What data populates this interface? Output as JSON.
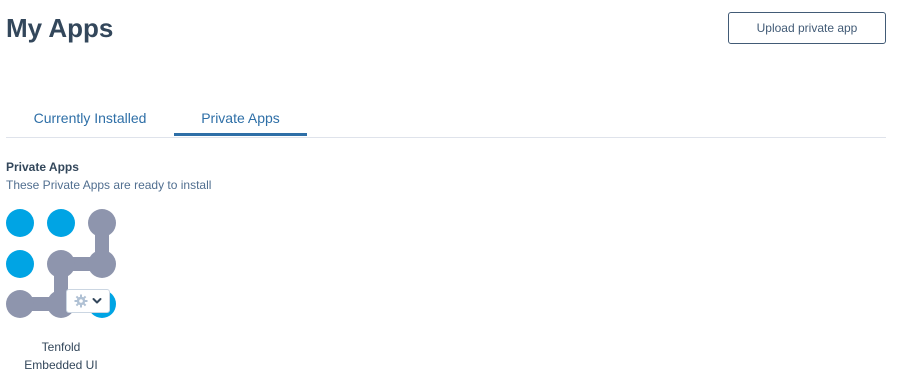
{
  "header": {
    "title": "My Apps",
    "upload_button_label": "Upload private app"
  },
  "tabs": [
    {
      "label": "Currently Installed",
      "active": false
    },
    {
      "label": "Private Apps",
      "active": true
    }
  ],
  "section": {
    "heading": "Private Apps",
    "subtitle": "These Private Apps are ready to install"
  },
  "apps": [
    {
      "name_line1": "Tenfold",
      "name_line2": "Embedded UI",
      "logo_icon": "tenfold-dots-logo",
      "menu_icons": [
        "gear-icon",
        "chevron-down-icon"
      ]
    }
  ],
  "colors": {
    "accent": "#2e6fa7",
    "logo_blue": "#00a4e4",
    "logo_gray": "#8e95ad",
    "text": "#33475b"
  }
}
